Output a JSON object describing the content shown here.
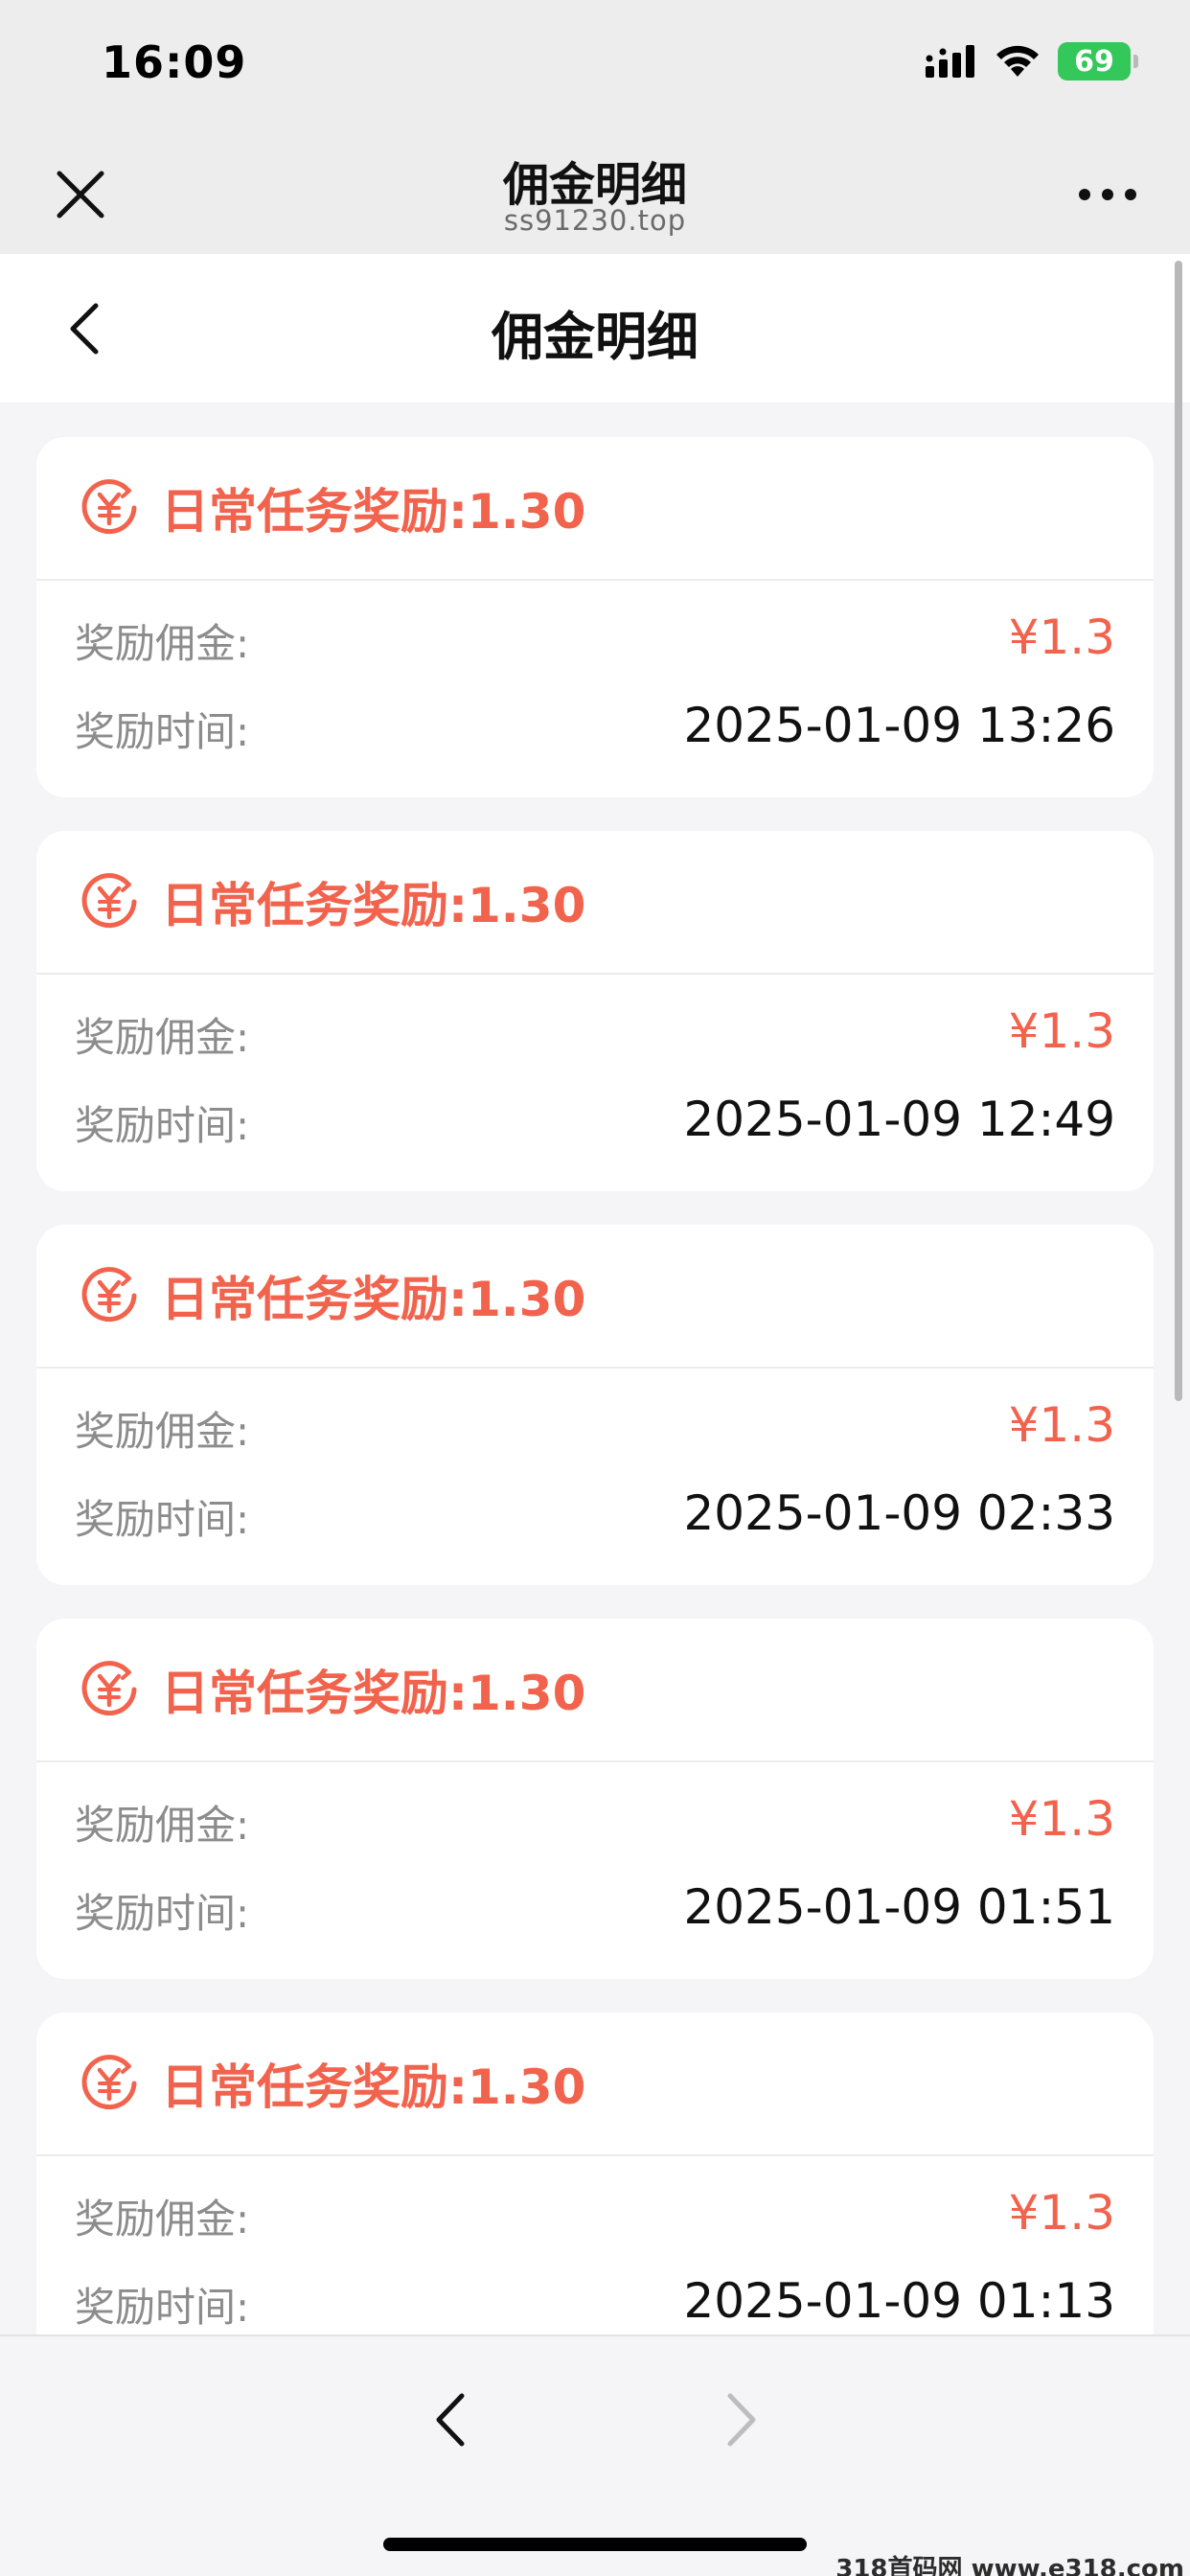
{
  "status_bar": {
    "time": "16:09",
    "battery": "69"
  },
  "browser": {
    "title": "佣金明细",
    "url": "ss91230.top"
  },
  "page": {
    "title": "佣金明细"
  },
  "labels": {
    "amount": "奖励佣金:",
    "time": "奖励时间:"
  },
  "records": [
    {
      "title": "日常任务奖励:1.30",
      "amount": "¥1.3",
      "time": "2025-01-09 13:26"
    },
    {
      "title": "日常任务奖励:1.30",
      "amount": "¥1.3",
      "time": "2025-01-09 12:49"
    },
    {
      "title": "日常任务奖励:1.30",
      "amount": "¥1.3",
      "time": "2025-01-09 02:33"
    },
    {
      "title": "日常任务奖励:1.30",
      "amount": "¥1.3",
      "time": "2025-01-09 01:51"
    },
    {
      "title": "日常任务奖励:1.30",
      "amount": "¥1.3",
      "time": "2025-01-09 01:13"
    }
  ],
  "watermark": "318首码网 www.e318.com",
  "colors": {
    "accent": "#f2634d",
    "battery": "#34c759",
    "background": "#f5f5f7"
  },
  "icons": {
    "close": "close-icon",
    "more": "more-icon",
    "back": "chevron-left-icon",
    "coin": "yen-coin-icon"
  }
}
